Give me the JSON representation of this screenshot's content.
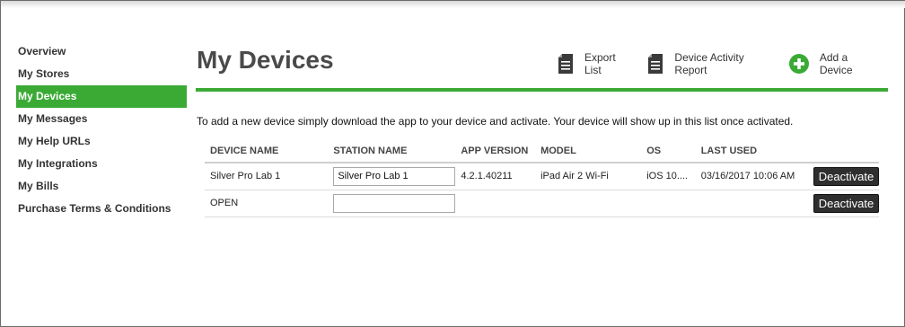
{
  "sidebar": {
    "items": [
      {
        "label": "Overview"
      },
      {
        "label": "My Stores"
      },
      {
        "label": "My Devices"
      },
      {
        "label": "My Messages"
      },
      {
        "label": "My Help URLs"
      },
      {
        "label": "My Integrations"
      },
      {
        "label": "My Bills"
      },
      {
        "label": "Purchase Terms & Conditions"
      }
    ],
    "active_index": 2
  },
  "header": {
    "title": "My Devices",
    "actions": [
      {
        "label": "Export List",
        "icon": "document-icon"
      },
      {
        "label": "Device Activity Report",
        "icon": "document-icon"
      },
      {
        "label": "Add a Device",
        "icon": "plus-circle-icon"
      }
    ]
  },
  "instructions": "To add a new device simply download the app to your device and activate. Your device will show up in this list once activated.",
  "table": {
    "columns": [
      "DEVICE NAME",
      "STATION NAME",
      "APP VERSION",
      "MODEL",
      "OS",
      "LAST USED"
    ],
    "rows": [
      {
        "device_name": "Silver Pro Lab 1",
        "station_name": "Silver Pro Lab 1",
        "app_version": "4.2.1.40211",
        "model": "iPad Air 2 Wi-Fi",
        "os": "iOS 10....",
        "last_used": "03/16/2017 10:06 AM",
        "button": "Deactivate"
      },
      {
        "device_name": "OPEN",
        "station_name": "",
        "app_version": "",
        "model": "",
        "os": "",
        "last_used": "",
        "button": "Deactivate"
      }
    ]
  },
  "colors": {
    "accent": "#3aaa35",
    "button_bg": "#2f2f2f"
  }
}
